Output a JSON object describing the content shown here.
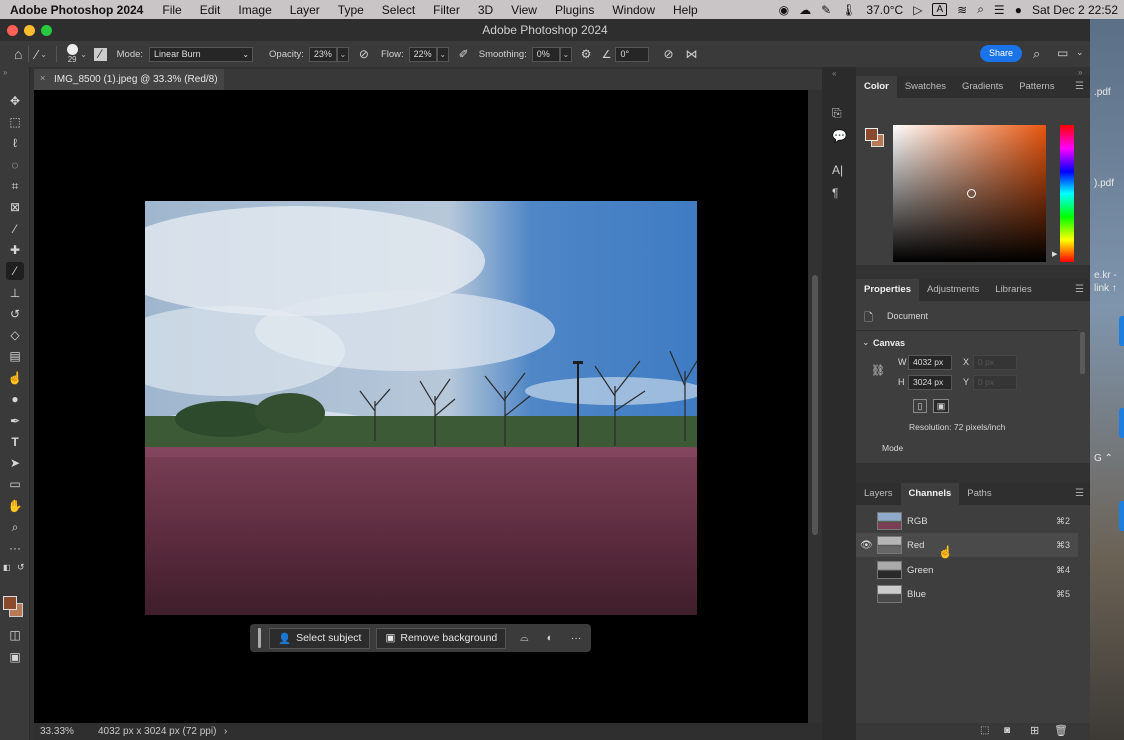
{
  "menubar": {
    "app": "Adobe Photoshop 2024",
    "items": [
      "File",
      "Edit",
      "Image",
      "Layer",
      "Type",
      "Select",
      "Filter",
      "3D",
      "View",
      "Plugins",
      "Window",
      "Help"
    ],
    "temperature": "37.0°C",
    "input_badge": "A",
    "datetime": "Sat Dec 2  22:52"
  },
  "window": {
    "title": "Adobe Photoshop 2024"
  },
  "options": {
    "brush_size": "29",
    "mode_label": "Mode:",
    "mode_value": "Linear Burn",
    "opacity_label": "Opacity:",
    "opacity_value": "23%",
    "flow_label": "Flow:",
    "flow_value": "22%",
    "smoothing_label": "Smoothing:",
    "smoothing_value": "0%",
    "angle_value": "0°",
    "share_label": "Share"
  },
  "document": {
    "tab_title": "IMG_8500 (1).jpeg @ 33.3% (Red/8)",
    "zoom": "33.33%",
    "info": "4032 px x 3024 px (72 ppi)",
    "info_arrow": "›"
  },
  "contextbar": {
    "select_subject": "Select subject",
    "remove_background": "Remove background",
    "more": "···"
  },
  "color_panel": {
    "tabs": [
      "Color",
      "Swatches",
      "Gradients",
      "Patterns"
    ],
    "foreground": "#8a4a2e",
    "background": "#b87a55"
  },
  "properties_panel": {
    "tabs": [
      "Properties",
      "Adjustments",
      "Libraries"
    ],
    "doc_label": "Document",
    "section": "Canvas",
    "w_label": "W",
    "w_value": "4032 px",
    "h_label": "H",
    "h_value": "3024 px",
    "x_label": "X",
    "x_placeholder": "0 px",
    "y_label": "Y",
    "y_placeholder": "0 px",
    "resolution": "Resolution: 72 pixels/inch",
    "mode_label": "Mode"
  },
  "channels_panel": {
    "tabs": [
      "Layers",
      "Channels",
      "Paths"
    ],
    "channels": [
      {
        "name": "RGB",
        "shortcut": "⌘2"
      },
      {
        "name": "Red",
        "shortcut": "⌘3"
      },
      {
        "name": "Green",
        "shortcut": "⌘4"
      },
      {
        "name": "Blue",
        "shortcut": "⌘5"
      }
    ]
  },
  "desktop": {
    "labels": [
      ".pdf",
      ").pdf",
      "e.kr -",
      "link ↑",
      "G ⌃"
    ]
  }
}
